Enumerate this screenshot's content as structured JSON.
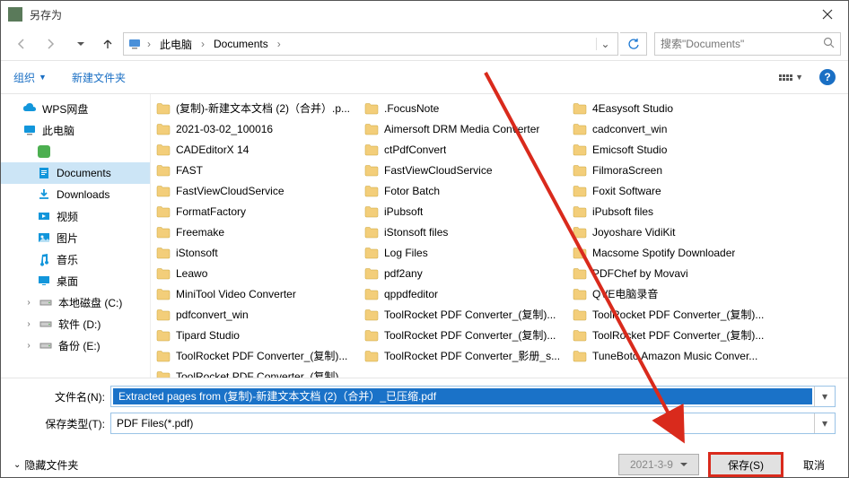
{
  "title": "另存为",
  "breadcrumb": {
    "seg1": "此电脑",
    "seg2": "Documents"
  },
  "search_placeholder": "搜索\"Documents\"",
  "toolbar": {
    "organize": "组织",
    "newfolder": "新建文件夹"
  },
  "sidebar": [
    {
      "label": "WPS网盘",
      "icon": "cloud",
      "color": "#1296db"
    },
    {
      "label": "此电脑",
      "icon": "monitor",
      "color": "#1296db"
    },
    {
      "label": "",
      "icon": "green-app",
      "color": "#4caf50",
      "lvl": 2
    },
    {
      "label": "Documents",
      "icon": "doc",
      "color": "#1296db",
      "lvl": 2,
      "selected": true
    },
    {
      "label": "Downloads",
      "icon": "download",
      "color": "#1296db",
      "lvl": 2
    },
    {
      "label": "视频",
      "icon": "video",
      "color": "#1296db",
      "lvl": 2
    },
    {
      "label": "图片",
      "icon": "image",
      "color": "#1296db",
      "lvl": 2
    },
    {
      "label": "音乐",
      "icon": "music",
      "color": "#1296db",
      "lvl": 2
    },
    {
      "label": "桌面",
      "icon": "desktop",
      "color": "#1296db",
      "lvl": 2
    },
    {
      "label": "本地磁盘 (C:)",
      "icon": "drive",
      "color": "#888",
      "lvl": 2,
      "chev": true
    },
    {
      "label": "软件 (D:)",
      "icon": "drive",
      "color": "#888",
      "lvl": 2,
      "chev": true
    },
    {
      "label": "备份 (E:)",
      "icon": "drive",
      "color": "#888",
      "lvl": 2,
      "chev": true
    }
  ],
  "columns": [
    [
      "(复制)-新建文本文档 (2)（合并）.p...",
      "2021-03-02_100016",
      "CADEditorX 14",
      "FAST",
      "FastViewCloudService",
      "FormatFactory",
      "Freemake",
      "iStonsoft",
      "Leawo",
      "MiniTool Video Converter",
      "pdfconvert_win",
      "Tipard Studio",
      "ToolRocket PDF Converter_(复制)...",
      "ToolRocket PDF Converter_(复制)..."
    ],
    [
      ".FocusNote",
      "Aimersoft DRM Media Converter",
      "ctPdfConvert",
      "FastViewCloudService",
      "Fotor Batch",
      "iPubsoft",
      "iStonsoft files",
      "Log Files",
      "pdf2any",
      "qppdfeditor",
      "ToolRocket PDF Converter_(复制)...",
      "ToolRocket PDF Converter_(复制)...",
      "ToolRocket PDF Converter_影册_s..."
    ],
    [
      "4Easysoft Studio",
      "cadconvert_win",
      "Emicsoft Studio",
      "FilmoraScreen",
      "Foxit Software",
      "iPubsoft files",
      "Joyoshare VidiKit",
      "Macsome Spotify Downloader",
      "PDFChef by Movavi",
      "QVE电脑录音",
      "ToolRocket PDF Converter_(复制)...",
      "ToolRocket PDF Converter_(复制)...",
      "TuneBoto Amazon Music Conver..."
    ]
  ],
  "filename_label": "文件名(N):",
  "filename_value": "Extracted pages from (复制)-新建文本文档 (2)（合并）_已压缩.pdf",
  "filetype_label": "保存类型(T):",
  "filetype_value": "PDF Files(*.pdf)",
  "hide_folders": "隐藏文件夹",
  "date_btn": "2021-3-9",
  "save_btn": "保存(S)",
  "cancel_btn": "取消"
}
